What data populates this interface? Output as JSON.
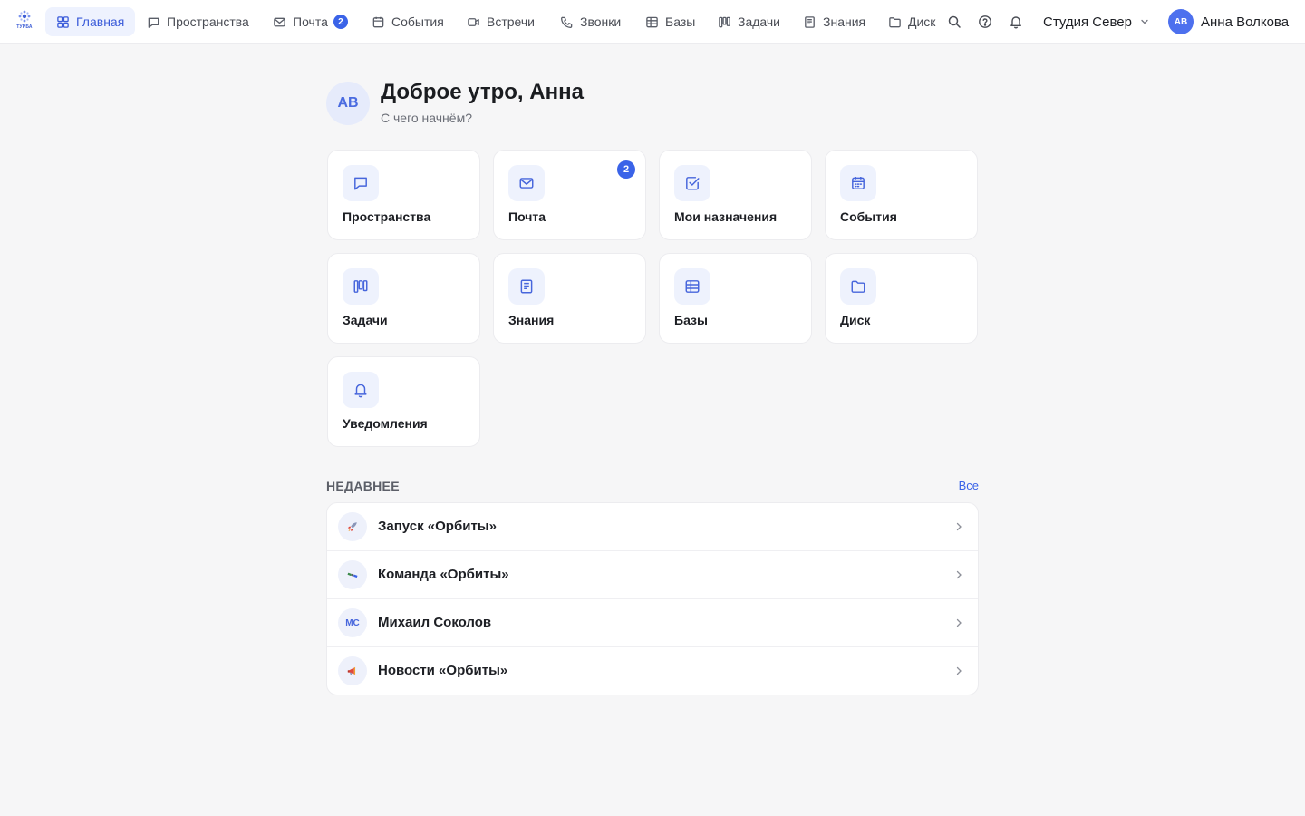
{
  "app": {
    "logo_text": "ТУРБА"
  },
  "nav": [
    {
      "label": "Главная",
      "icon": "grid-icon",
      "active": true
    },
    {
      "label": "Пространства",
      "icon": "chat-bubble-icon"
    },
    {
      "label": "Почта",
      "icon": "mail-icon",
      "badge": "2"
    },
    {
      "label": "События",
      "icon": "calendar-icon"
    },
    {
      "label": "Встречи",
      "icon": "video-icon"
    },
    {
      "label": "Звонки",
      "icon": "phone-icon"
    },
    {
      "label": "Базы",
      "icon": "table-icon"
    },
    {
      "label": "Задачи",
      "icon": "kanban-icon"
    },
    {
      "label": "Знания",
      "icon": "notebook-icon"
    },
    {
      "label": "Диск",
      "icon": "folder-icon"
    }
  ],
  "topbar": {
    "workspace": "Студия Север",
    "user_initials": "АВ",
    "user_name": "Анна Волкова"
  },
  "greeting": {
    "initials": "АВ",
    "title": "Доброе утро, Анна",
    "subtitle": "С чего начнём?"
  },
  "tiles": [
    {
      "label": "Пространства",
      "icon": "chat-bubble-icon"
    },
    {
      "label": "Почта",
      "icon": "mail-icon",
      "badge": "2"
    },
    {
      "label": "Мои назначения",
      "icon": "checkbox-icon"
    },
    {
      "label": "События",
      "icon": "calendar-icon"
    },
    {
      "label": "Задачи",
      "icon": "kanban-icon"
    },
    {
      "label": "Знания",
      "icon": "notebook-icon"
    },
    {
      "label": "Базы",
      "icon": "table-icon"
    },
    {
      "label": "Диск",
      "icon": "folder-icon"
    },
    {
      "label": "Уведомления",
      "icon": "bell-icon"
    }
  ],
  "recent": {
    "title": "НЕДАВНЕЕ",
    "all_link": "Все",
    "items": [
      {
        "label": "Запуск «Орбиты»",
        "icon": "rocket-icon"
      },
      {
        "label": "Команда «Орбиты»",
        "icon": "satellite-icon"
      },
      {
        "label": "Михаил Соколов",
        "initials": "МС"
      },
      {
        "label": "Новости «Орбиты»",
        "icon": "megaphone-icon"
      }
    ]
  },
  "colors": {
    "accent": "#3a63e8",
    "accent_soft": "#eef2fd",
    "background": "#f6f6f7",
    "avatar": "#4d70ee"
  }
}
